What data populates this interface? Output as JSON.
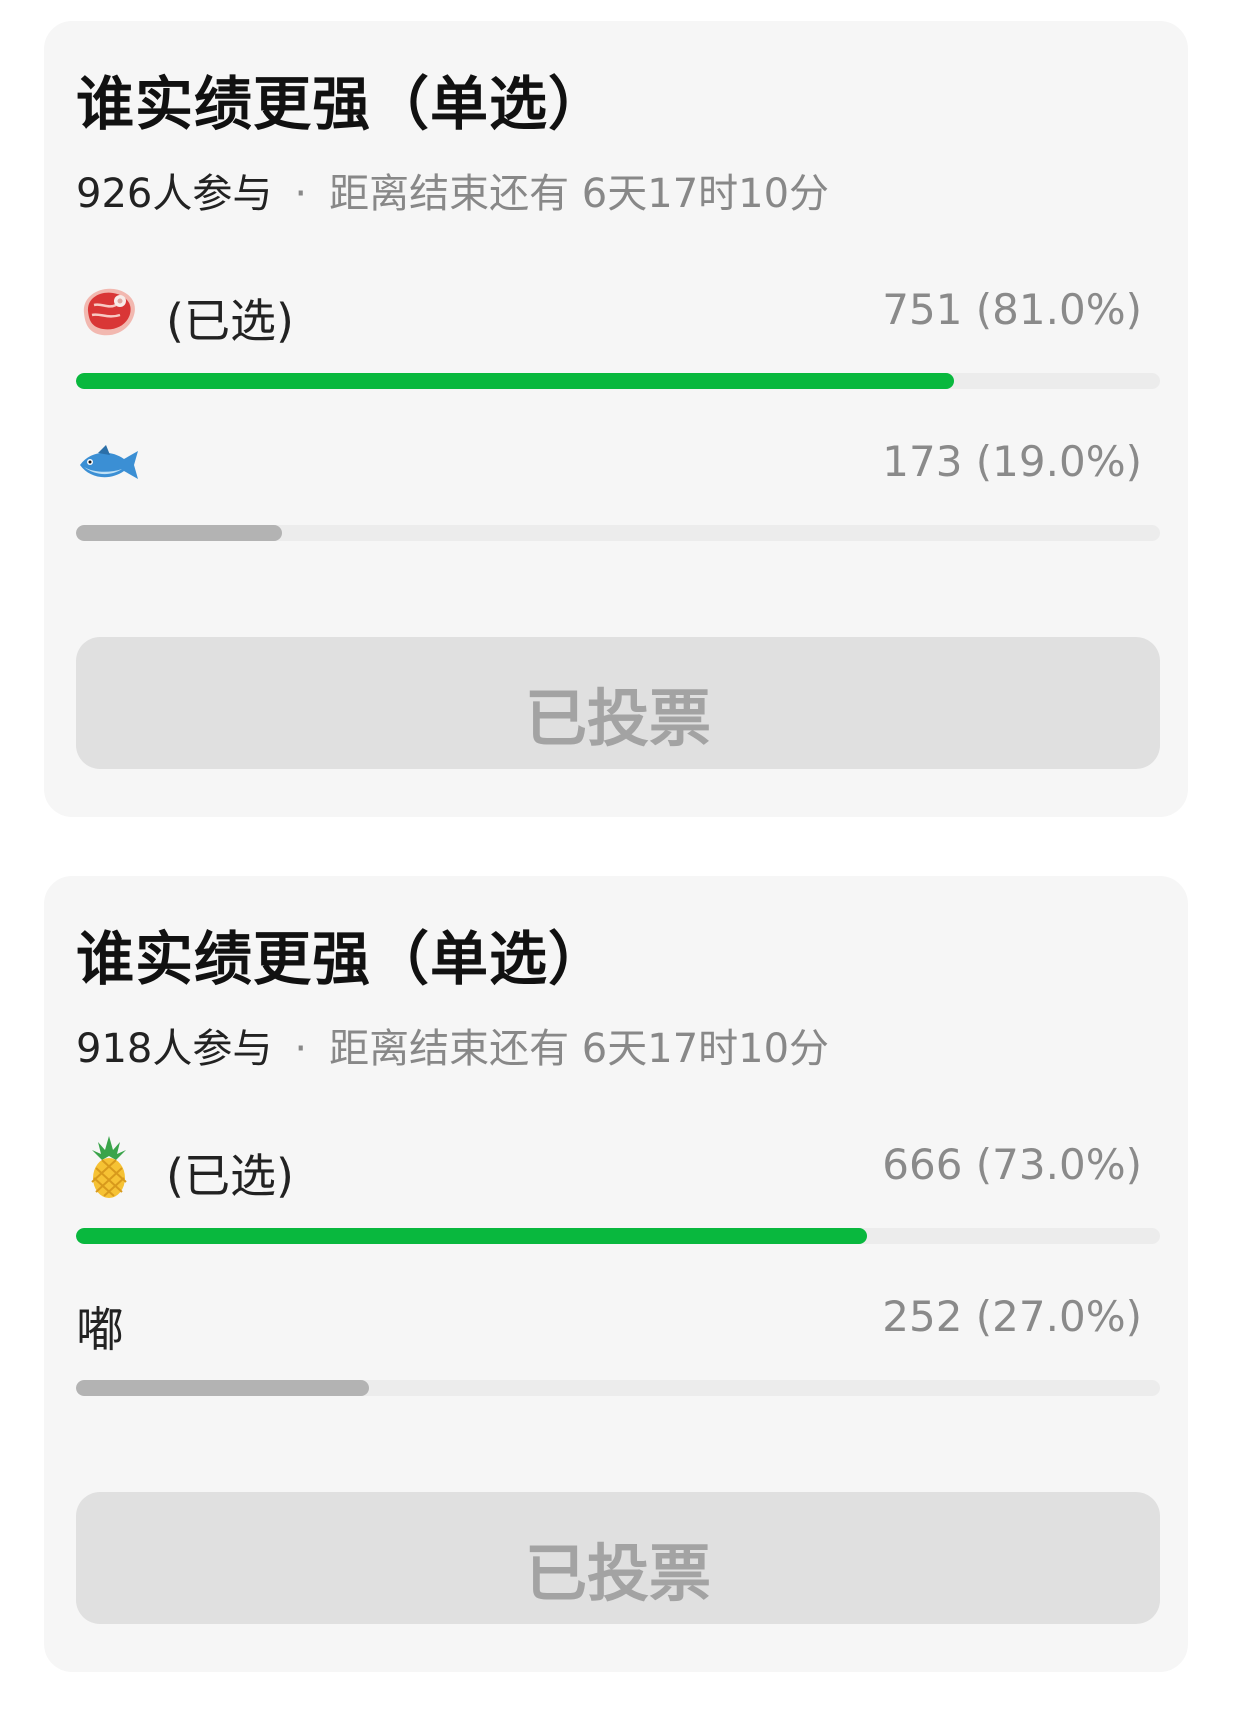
{
  "colors": {
    "card_background": "#f6f6f6",
    "selected_bar": "#09b83e",
    "unselected_bar": "#b3b3b3",
    "bar_track": "#ececec",
    "button_background": "#e0e0e0",
    "button_text": "#a3a3a3"
  },
  "polls": [
    {
      "title": "谁实绩更强（单选）",
      "participants": "926人参与",
      "separator": "·",
      "time_remaining": "距离结束还有 6天17时10分",
      "options": [
        {
          "icon": "meat-steak-icon",
          "label": "",
          "selected_tag": "(已选)",
          "count_text": "751 (81.0%)",
          "percent": 81.0,
          "selected": true
        },
        {
          "icon": "fish-icon",
          "label": "",
          "selected_tag": "",
          "count_text": "173 (19.0%)",
          "percent": 19.0,
          "selected": false
        }
      ],
      "button_label": "已投票"
    },
    {
      "title": "谁实绩更强（单选）",
      "participants": "918人参与",
      "separator": "·",
      "time_remaining": "距离结束还有 6天17时10分",
      "options": [
        {
          "icon": "pineapple-icon",
          "label": "",
          "selected_tag": "(已选)",
          "count_text": "666 (73.0%)",
          "percent": 73.0,
          "selected": true
        },
        {
          "icon": "",
          "label": "嘟",
          "selected_tag": "",
          "count_text": "252 (27.0%)",
          "percent": 27.0,
          "selected": false
        }
      ],
      "button_label": "已投票"
    }
  ]
}
